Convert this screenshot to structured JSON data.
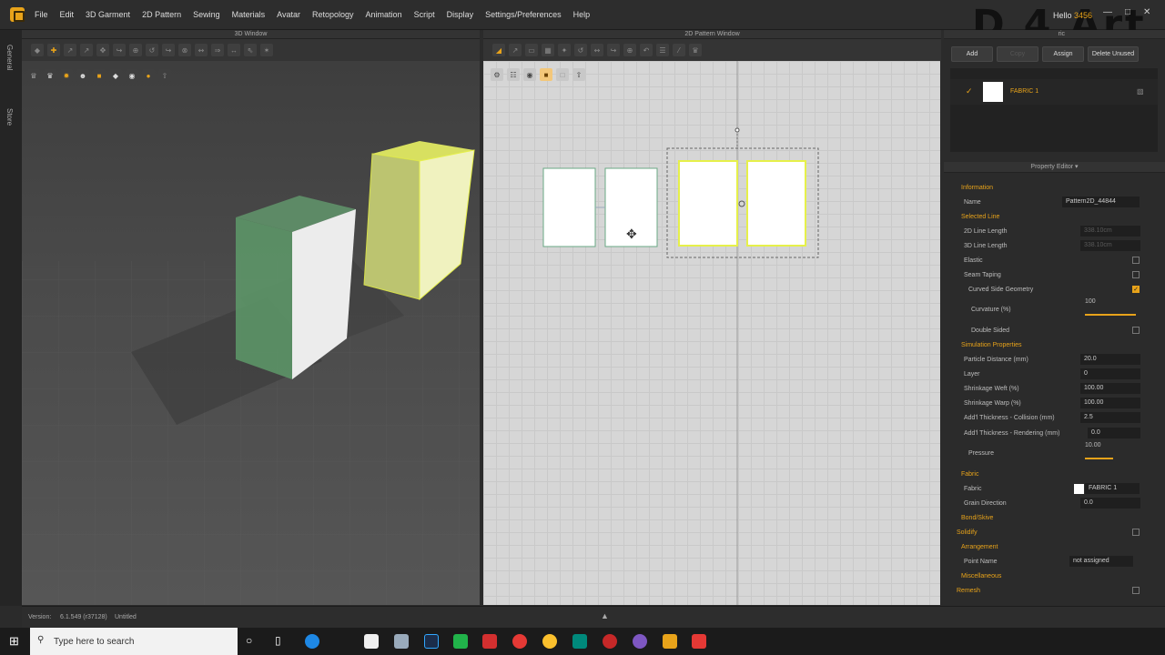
{
  "app": {
    "menu": [
      "File",
      "Edit",
      "3D Garment",
      "2D Pattern",
      "Sewing",
      "Materials",
      "Avatar",
      "Retopology",
      "Animation",
      "Script",
      "Display",
      "Settings/Preferences",
      "Help"
    ],
    "user_greeting": "Hello",
    "user_id": "3456",
    "watermark": "D 4 Art",
    "side_tabs": [
      "General",
      "Store"
    ]
  },
  "window3d": {
    "title": "3D Window"
  },
  "window2d": {
    "title": "2D Pattern Window"
  },
  "object_browser": {
    "tab_label": "ric",
    "buttons": {
      "add": "Add",
      "copy": "Copy",
      "assign": "Assign",
      "delete_unused": "Delete Unused"
    },
    "fabric_name": "FABRIC 1"
  },
  "property_editor": {
    "title": "Property Editor",
    "information": "Information",
    "name_label": "Name",
    "name_value": "Pattern2D_44844",
    "selected_line": "Selected Line",
    "line_2d": "2D Line Length",
    "line_2d_val": "338.10cm",
    "line_3d": "3D Line Length",
    "line_3d_val": "338.10cm",
    "elastic": "Elastic",
    "seam_taping": "Seam Taping",
    "curved_side": "Curved Side Geometry",
    "curvature": "Curvature (%)",
    "curvature_val": "100",
    "double_sided": "Double Sided",
    "simulation": "Simulation Properties",
    "particle_distance": "Particle Distance (mm)",
    "particle_distance_val": "20.0",
    "layer": "Layer",
    "layer_val": "0",
    "shrink_weft": "Shrinkage Weft (%)",
    "shrink_weft_val": "100.00",
    "shrink_warp": "Shrinkage Warp (%)",
    "shrink_warp_val": "100.00",
    "thick_collision": "Add'l Thickness - Collision (mm)",
    "thick_collision_val": "2.5",
    "thick_render": "Add'l Thickness - Rendering (mm)",
    "thick_render_val": "0.0",
    "pressure": "Pressure",
    "pressure_val": "10.00",
    "fabric_section": "Fabric",
    "fabric_label": "Fabric",
    "fabric_val": "FABRIC 1",
    "grain": "Grain Direction",
    "grain_val": "0.0",
    "bond": "Bond/Skive",
    "solidify": "Solidify",
    "arrangement": "Arrangement",
    "point_name": "Point Name",
    "point_name_val": "not assigned",
    "misc": "Miscellaneous",
    "remesh": "Remesh"
  },
  "status": {
    "version_label": "Version:",
    "version": "6.1.549 (r37128)",
    "file": "Untitled"
  },
  "taskbar": {
    "search_placeholder": "Type here to search"
  },
  "colors": {
    "accent": "#e8a31a",
    "select": "#e6f04a"
  },
  "levels": {
    "curvature_pct": 100,
    "pressure_fraction": 0.55
  }
}
